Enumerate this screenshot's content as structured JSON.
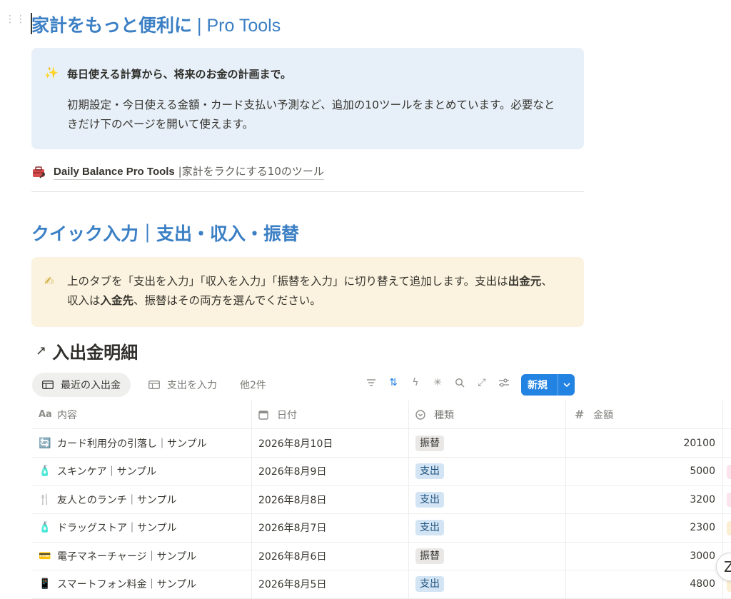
{
  "page": {
    "title_main": "家計をもっと便利に",
    "title_separator": "|",
    "title_sub": "Pro Tools"
  },
  "callout_intro": {
    "icon": "sparkles-icon",
    "heading": "毎日使える計算から、将来のお金の計画まで。",
    "body": "初期設定・今日使える金額・カード支払い予測など、追加の10ツールをまとめています。必要なときだけ下のページを開いて使えます。"
  },
  "page_link": {
    "title": "Daily Balance Pro Tools",
    "separator": "|",
    "subtitle": "家計をラクにする10のツール"
  },
  "section": {
    "heading": "クイック入力｜支出・収入・振替"
  },
  "callout_help": {
    "icon": "writing-hand-icon",
    "part1": "上のタブを「支出を入力」「収入を入力」「振替を入力」に切り替えて追加します。支出は",
    "bold1": "出金元",
    "part2": "、収入は",
    "bold2": "入金先",
    "part3": "、振替はその両方を選んでください。"
  },
  "database": {
    "title": "入出金明細",
    "tabs": [
      {
        "label": "最近の入出金",
        "active": true
      },
      {
        "label": "支出を入力",
        "active": false
      }
    ],
    "more_views": "他2件",
    "new_button": "新規",
    "columns": [
      {
        "label": "内容",
        "icon": "Aa"
      },
      {
        "label": "日付",
        "icon": "calendar-icon"
      },
      {
        "label": "種類",
        "icon": "select-icon"
      },
      {
        "label": "金額",
        "icon": "#"
      }
    ],
    "rows": [
      {
        "icon": "🔄",
        "name": "カード利用分の引落し｜サンプル",
        "date": "2026年8月10日",
        "type": "振替",
        "amount": "20100",
        "stub": ""
      },
      {
        "icon": "🧴",
        "name": "スキンケア｜サンプル",
        "date": "2026年8月9日",
        "type": "支出",
        "amount": "5000",
        "stub": "#fbe4ec"
      },
      {
        "icon": "🍴",
        "name": "友人とのランチ｜サンプル",
        "date": "2026年8月8日",
        "type": "支出",
        "amount": "3200",
        "stub": "#fbe4ec"
      },
      {
        "icon": "🧴",
        "name": "ドラッグストア｜サンプル",
        "date": "2026年8月7日",
        "type": "支出",
        "amount": "2300",
        "stub": "#fbeed3"
      },
      {
        "icon": "💳",
        "name": "電子マネーチャージ｜サンプル",
        "date": "2026年8月6日",
        "type": "振替",
        "amount": "3000",
        "stub": ""
      },
      {
        "icon": "📱",
        "name": "スマートフォン料金｜サンプル",
        "date": "2026年8月5日",
        "type": "支出",
        "amount": "4800",
        "stub": "#fbeed3"
      }
    ]
  },
  "floating_button": "Z",
  "colors": {
    "accent": "#3b7fc4",
    "button_blue": "#2383e2",
    "callout_blue": "#e7f0f9",
    "callout_yellow": "#fbf3df",
    "badge_expense": "#d3e5f5",
    "badge_transfer": "#e9e8e6"
  }
}
